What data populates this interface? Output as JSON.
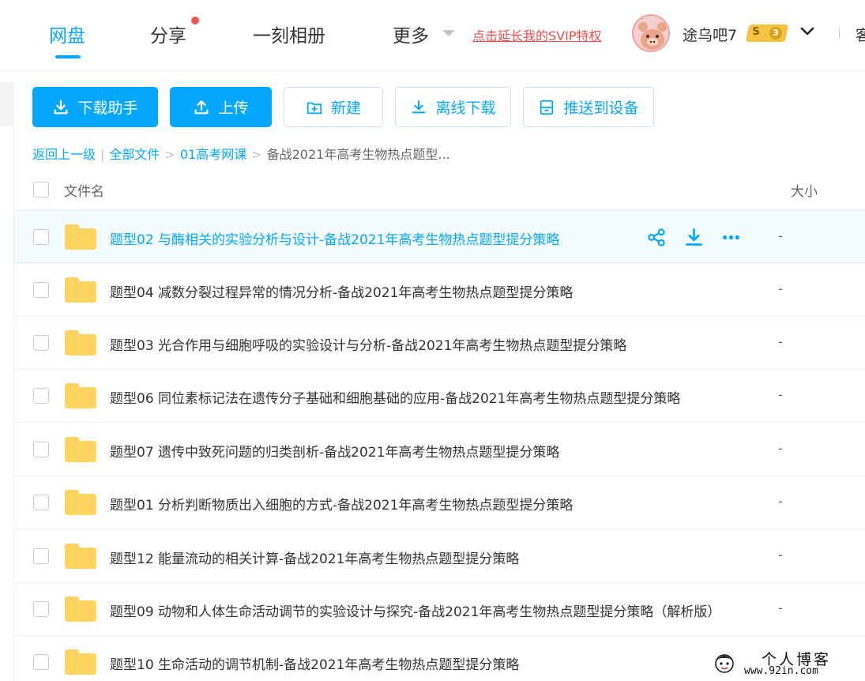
{
  "nav": {
    "tabs": [
      {
        "label": "网盘",
        "active": true
      },
      {
        "label": "分享",
        "has_dot": true
      },
      {
        "label": "一刻相册"
      },
      {
        "label": "更多"
      }
    ],
    "svip_link": "点击延长我的SVIP特权",
    "username": "途乌吧7",
    "badge": {
      "symbol": "S",
      "level": "3"
    },
    "cut_off_text": "客"
  },
  "toolbar": {
    "download_helper": "下载助手",
    "upload": "上传",
    "new": "新建",
    "offline_download": "离线下载",
    "push_to_device": "推送到设备"
  },
  "breadcrumb": {
    "back": "返回上一级",
    "all_files": "全部文件",
    "folder": "01高考网课",
    "current": "备战2021年高考生物热点题型..."
  },
  "table": {
    "col_name": "文件名",
    "col_size": "大小",
    "rows": [
      {
        "name": "题型02 与酶相关的实验分析与设计-备战2021年高考生物热点题型提分策略",
        "size": "-",
        "hover": true
      },
      {
        "name": "题型04 减数分裂过程异常的情况分析-备战2021年高考生物热点题型提分策略",
        "size": "-"
      },
      {
        "name": "题型03 光合作用与细胞呼吸的实验设计与分析-备战2021年高考生物热点题型提分策略",
        "size": "-"
      },
      {
        "name": "题型06 同位素标记法在遗传分子基础和细胞基础的应用-备战2021年高考生物热点题型提分策略",
        "size": "-"
      },
      {
        "name": "题型07 遗传中致死问题的归类剖析-备战2021年高考生物热点题型提分策略",
        "size": "-"
      },
      {
        "name": "题型01 分析判断物质出入细胞的方式-备战2021年高考生物热点题型提分策略",
        "size": "-"
      },
      {
        "name": "题型12 能量流动的相关计算-备战2021年高考生物热点题型提分策略",
        "size": "-"
      },
      {
        "name": "题型09 动物和人体生命活动调节的实验设计与探究-备战2021年高考生物热点题型提分策略（解析版）",
        "size": "-"
      },
      {
        "name": "题型10 生命活动的调节机制-备战2021年高考生物热点题型提分策略",
        "size": ""
      }
    ]
  },
  "watermark": {
    "title": "个人博客",
    "url": "www.92in.com"
  },
  "colors": {
    "accent": "#06a7ff",
    "svip": "#f04c4c",
    "folder": "#ffd561",
    "badge": "#f5c244"
  }
}
